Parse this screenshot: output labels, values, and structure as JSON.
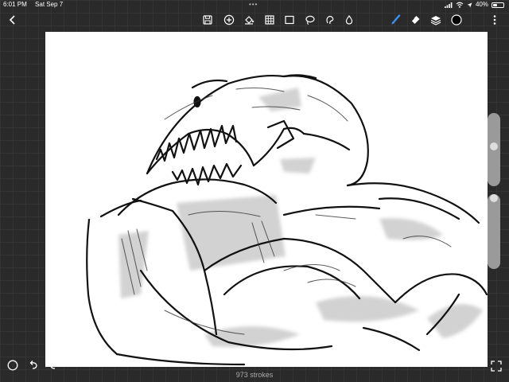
{
  "status": {
    "time": "6:01 PM",
    "date": "Sat Sep 7",
    "battery": "40%",
    "battery_level": 0.4,
    "grabber": "•••"
  },
  "toolbar": {
    "left": [
      {
        "name": "back-icon"
      }
    ],
    "center": [
      {
        "name": "save-icon"
      },
      {
        "name": "add-icon"
      },
      {
        "name": "fill-icon"
      },
      {
        "name": "grid-icon"
      },
      {
        "name": "rectangle-select-icon"
      },
      {
        "name": "lasso-icon"
      },
      {
        "name": "smudge-icon"
      },
      {
        "name": "blur-icon"
      }
    ],
    "right": [
      {
        "name": "brush-icon",
        "active": true,
        "color": "#3b8ff5"
      },
      {
        "name": "eraser-icon"
      },
      {
        "name": "layers-icon"
      },
      {
        "name": "color-swatch",
        "color": "#000000"
      },
      {
        "name": "more-icon"
      }
    ]
  },
  "side_slider": {
    "size_icon": "brush-size-icon",
    "opacity_icon": "opacity-icon"
  },
  "footer": {
    "stroke_count": "973 strokes"
  },
  "bottom_tools": [
    {
      "name": "circle-tool-icon"
    },
    {
      "name": "undo-icon"
    },
    {
      "name": "redo-icon"
    }
  ],
  "bottom_right": {
    "name": "fullscreen-icon"
  }
}
